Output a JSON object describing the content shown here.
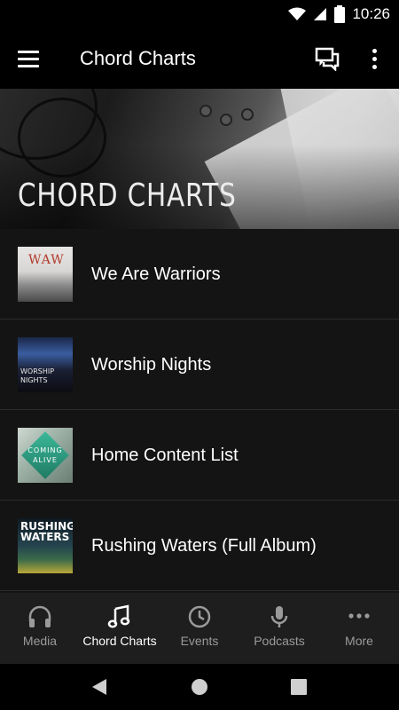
{
  "status_bar": {
    "time": "10:26"
  },
  "app_bar": {
    "title": "Chord Charts",
    "menu_icon": "hamburger-menu-icon",
    "chat_icon": "chat-bubbles-icon",
    "overflow_icon": "more-vert-icon"
  },
  "hero": {
    "title": "CHORD CHARTS"
  },
  "items": [
    {
      "label": "We Are Warriors",
      "thumb_text": "WAW"
    },
    {
      "label": "Worship Nights",
      "thumb_text_1": "WORSHIP",
      "thumb_text_2": "NIGHTS"
    },
    {
      "label": "Home Content List",
      "thumb_text_1": "COMING",
      "thumb_text_2": "ALIVE"
    },
    {
      "label": "Rushing Waters (Full Album)",
      "thumb_text_1": "RUSHING",
      "thumb_text_2": "WATERS"
    }
  ],
  "bottom_nav": [
    {
      "label": "Media",
      "icon": "headphones-icon",
      "active": false
    },
    {
      "label": "Chord Charts",
      "icon": "music-note-icon",
      "active": true
    },
    {
      "label": "Events",
      "icon": "clock-icon",
      "active": false
    },
    {
      "label": "Podcasts",
      "icon": "microphone-icon",
      "active": false
    },
    {
      "label": "More",
      "icon": "more-horiz-icon",
      "active": false
    }
  ],
  "colors": {
    "background": "#141414",
    "bar": "#000000",
    "nav_bg": "#1e1e1e",
    "inactive": "#9a9a9a",
    "active": "#ffffff"
  }
}
